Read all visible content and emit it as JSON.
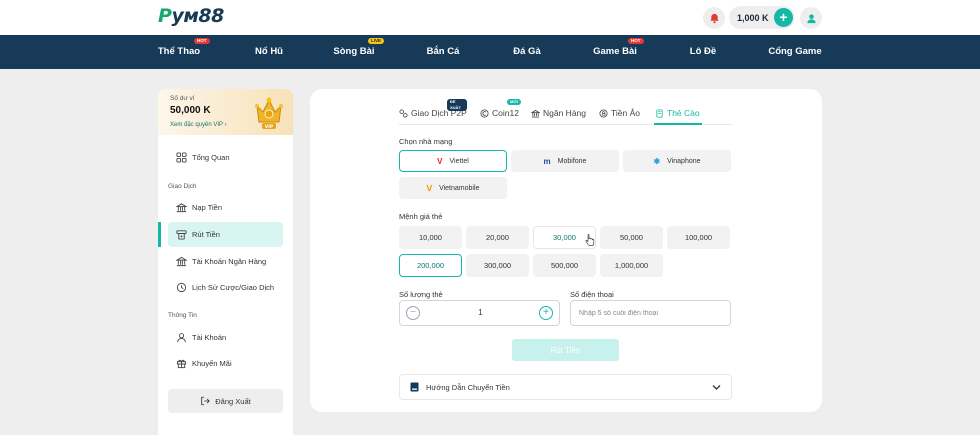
{
  "header": {
    "logo_text": "ум88",
    "logo_leading": "P",
    "balance": "1,000 K",
    "plus_symbol": "+"
  },
  "nav": {
    "items": [
      {
        "label": "Thể Thao",
        "badge": "HOT"
      },
      {
        "label": "Nổ Hũ",
        "badge": ""
      },
      {
        "label": "Sòng Bài",
        "badge": "LIVE"
      },
      {
        "label": "Bắn Cá",
        "badge": ""
      },
      {
        "label": "Đá Gà",
        "badge": ""
      },
      {
        "label": "Game Bài",
        "badge": "HOT"
      },
      {
        "label": "Lô Đề",
        "badge": ""
      },
      {
        "label": "Cổng Game",
        "badge": ""
      }
    ]
  },
  "sidebar": {
    "balance_label": "Số dư ví",
    "balance_value": "50,000 K",
    "vip_link": "Xem đặc quyền VIP",
    "vip_link_arrow": "›",
    "vip_badge": "VIP",
    "overview": "Tổng Quan",
    "group_transactions": "Giao Dịch",
    "deposit": "Nạp Tiền",
    "withdraw": "Rút Tiền",
    "bank_account": "Tài Khoản Ngân Hàng",
    "history": "Lịch Sử Cược/Giao Dịch",
    "group_info": "Thông Tin",
    "account": "Tài Khoản",
    "promotions": "Khuyến Mãi",
    "logout": "Đăng Xuất"
  },
  "tabs": [
    {
      "label": "Giao Dịch P2P",
      "badge": "ĐỀ XUẤT"
    },
    {
      "label": "Coin12",
      "badge": "MỚI"
    },
    {
      "label": "Ngân Hàng",
      "badge": ""
    },
    {
      "label": "Tiền Ảo",
      "badge": ""
    },
    {
      "label": "Thẻ Cào",
      "badge": ""
    }
  ],
  "form": {
    "carrier_label": "Chọn nhà mạng",
    "carriers": [
      {
        "name": "Viettel",
        "mark": "V"
      },
      {
        "name": "Mobifone",
        "mark": "m"
      },
      {
        "name": "Vinaphone",
        "mark": "✱"
      },
      {
        "name": "Vietnamobile",
        "mark": "ᐯ"
      }
    ],
    "selected_carrier": "Viettel",
    "denomination_label": "Mệnh giá thẻ",
    "denominations": [
      "10,000",
      "20,000",
      "30,000",
      "50,000",
      "100,000",
      "200,000",
      "300,000",
      "500,000",
      "1,000,000"
    ],
    "selected_denomination": "200,000",
    "quantity_label": "Số lượng thẻ",
    "quantity": "1",
    "minus_symbol": "−",
    "plus_symbol": "+",
    "phone_label": "Số điện thoại",
    "phone_placeholder": "Nhập 5 số cuối điện thoại",
    "phone_value": "",
    "submit_label": "Rút Tiền",
    "guide_label": "Hướng Dẫn Chuyển Tiền"
  },
  "colors": {
    "accent": "#14b8a6",
    "nav_bg": "#163a58",
    "hot_badge": "#e53935",
    "live_badge": "#f5c518",
    "viettel": "#e3262f",
    "mobifone": "#1f4e9e",
    "vinaphone": "#2ea3d8",
    "vietnamobile": "#f29100"
  }
}
